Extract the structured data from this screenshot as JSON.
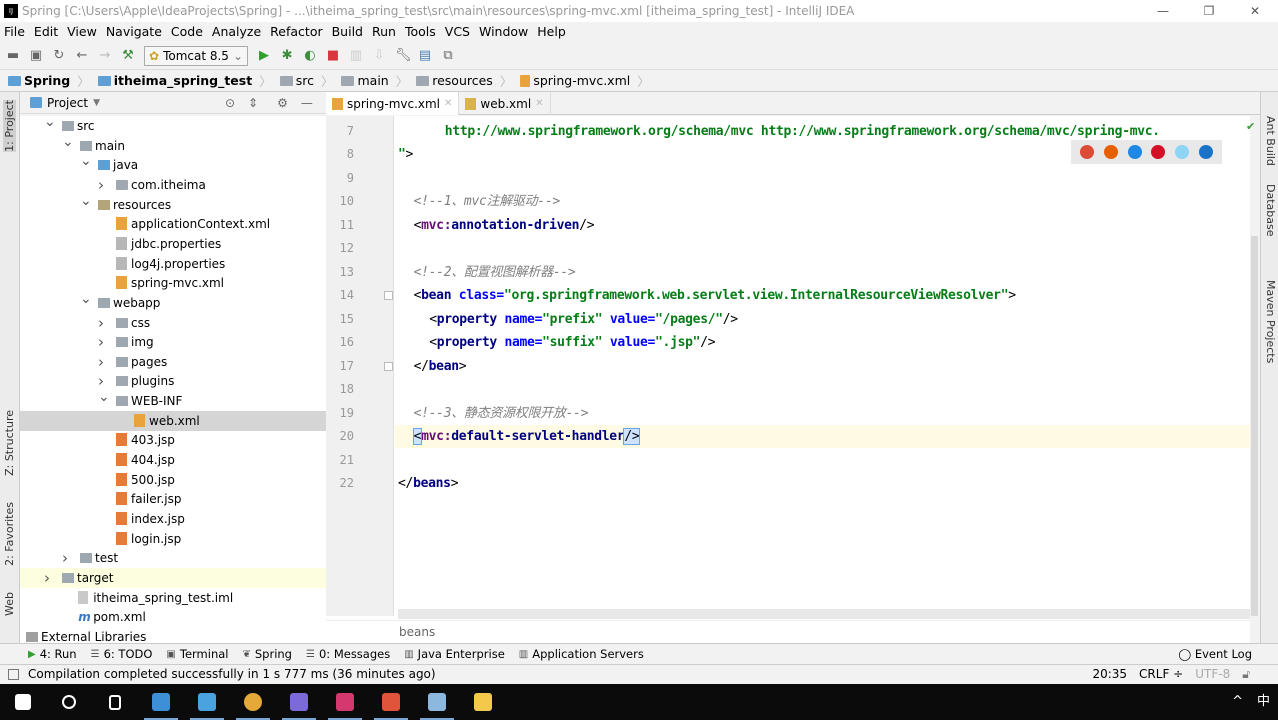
{
  "window": {
    "title": "Spring [C:\\Users\\Apple\\IdeaProjects\\Spring] - ...\\itheima_spring_test\\src\\main\\resources\\spring-mvc.xml [itheima_spring_test] - IntelliJ IDEA",
    "logo": "IJ",
    "controls": [
      "—",
      "❐",
      "✕"
    ]
  },
  "menu": [
    "File",
    "Edit",
    "View",
    "Navigate",
    "Code",
    "Analyze",
    "Refactor",
    "Build",
    "Run",
    "Tools",
    "VCS",
    "Window",
    "Help"
  ],
  "toolbar": {
    "run_config": "Tomcat 8.5",
    "icons": [
      "open-icon",
      "save-icon",
      "sync-icon",
      "back-icon",
      "forward-icon",
      "build-icon",
      "run-icon",
      "debug-icon",
      "coverage-icon",
      "stop-icon",
      "update-icon",
      "deploy-icon",
      "settings-icon",
      "project-structure-icon",
      "sdk-icon"
    ]
  },
  "breadcrumbs": [
    "Spring",
    "itheima_spring_test",
    "src",
    "main",
    "resources",
    "spring-mvc.xml"
  ],
  "left_stripe": [
    "1: Project",
    "Z: Structure",
    "2: Favorites",
    "Web"
  ],
  "right_stripe": [
    "Ant Build",
    "Database",
    "Maven Projects"
  ],
  "project": {
    "title": "Project",
    "tree": [
      {
        "label": "src",
        "depth": 0,
        "arrow": "down",
        "icon": "folder"
      },
      {
        "label": "main",
        "depth": 1,
        "arrow": "down",
        "icon": "folder"
      },
      {
        "label": "java",
        "depth": 2,
        "arrow": "down",
        "icon": "src"
      },
      {
        "label": "com.itheima",
        "depth": 3,
        "arrow": "right",
        "icon": "pkg"
      },
      {
        "label": "resources",
        "depth": 2,
        "arrow": "down",
        "icon": "res"
      },
      {
        "label": "applicationContext.xml",
        "depth": 3,
        "arrow": "",
        "icon": "xml"
      },
      {
        "label": "jdbc.properties",
        "depth": 3,
        "arrow": "",
        "icon": "props"
      },
      {
        "label": "log4j.properties",
        "depth": 3,
        "arrow": "",
        "icon": "props"
      },
      {
        "label": "spring-mvc.xml",
        "depth": 3,
        "arrow": "",
        "icon": "xml"
      },
      {
        "label": "webapp",
        "depth": 2,
        "arrow": "down",
        "icon": "folder"
      },
      {
        "label": "css",
        "depth": 3,
        "arrow": "right",
        "icon": "folder"
      },
      {
        "label": "img",
        "depth": 3,
        "arrow": "right",
        "icon": "folder"
      },
      {
        "label": "pages",
        "depth": 3,
        "arrow": "right",
        "icon": "folder"
      },
      {
        "label": "plugins",
        "depth": 3,
        "arrow": "right",
        "icon": "folder"
      },
      {
        "label": "WEB-INF",
        "depth": 3,
        "arrow": "down",
        "icon": "folder"
      },
      {
        "label": "web.xml",
        "depth": 4,
        "arrow": "",
        "icon": "xml",
        "selected": true
      },
      {
        "label": "403.jsp",
        "depth": 3,
        "arrow": "",
        "icon": "jsp"
      },
      {
        "label": "404.jsp",
        "depth": 3,
        "arrow": "",
        "icon": "jsp"
      },
      {
        "label": "500.jsp",
        "depth": 3,
        "arrow": "",
        "icon": "jsp"
      },
      {
        "label": "failer.jsp",
        "depth": 3,
        "arrow": "",
        "icon": "jsp"
      },
      {
        "label": "index.jsp",
        "depth": 3,
        "arrow": "",
        "icon": "jsp"
      },
      {
        "label": "login.jsp",
        "depth": 3,
        "arrow": "",
        "icon": "jsp"
      },
      {
        "label": "test",
        "depth": 1,
        "arrow": "right",
        "icon": "folder"
      },
      {
        "label": "target",
        "depth": 0,
        "arrow": "right",
        "icon": "folder",
        "highlight": true
      },
      {
        "label": "itheima_spring_test.iml",
        "depth": 0.9,
        "arrow": "",
        "icon": "iml"
      },
      {
        "label": "pom.xml",
        "depth": 0.9,
        "arrow": "",
        "icon": "pom"
      },
      {
        "label": "External Libraries",
        "depth": -2,
        "arrow": "right",
        "icon": "lib"
      }
    ]
  },
  "tabs": [
    {
      "label": "spring-mvc.xml",
      "active": true
    },
    {
      "label": "web.xml",
      "active": false
    }
  ],
  "editor": {
    "lines": [
      {
        "n": "7",
        "indent": 3,
        "tokens": [
          [
            "http://www.springframework.org/schema/mvc http://www.springframework.org/schema/mvc/spring-mvc.",
            "str"
          ]
        ]
      },
      {
        "n": "8",
        "indent": 0,
        "tokens": [
          [
            "\"",
            "str"
          ],
          [
            ">",
            "br"
          ]
        ]
      },
      {
        "n": "9",
        "indent": 0,
        "tokens": []
      },
      {
        "n": "10",
        "indent": 1,
        "tokens": [
          [
            "<!--1、mvc注解驱动-->",
            "cm"
          ]
        ]
      },
      {
        "n": "11",
        "indent": 1,
        "tokens": [
          [
            "<",
            "br"
          ],
          [
            "mvc:",
            "ns"
          ],
          [
            "annotation-driven",
            "tag"
          ],
          [
            "/>",
            "br"
          ]
        ]
      },
      {
        "n": "12",
        "indent": 0,
        "tokens": []
      },
      {
        "n": "13",
        "indent": 1,
        "tokens": [
          [
            "<!--2、配置视图解析器-->",
            "cm"
          ]
        ]
      },
      {
        "n": "14",
        "indent": 1,
        "tokens": [
          [
            "<",
            "br"
          ],
          [
            "bean ",
            "tag"
          ],
          [
            "class=",
            "attr"
          ],
          [
            "\"org.springframework.web.servlet.view.InternalResourceViewResolver\"",
            "str"
          ],
          [
            ">",
            "br"
          ]
        ]
      },
      {
        "n": "15",
        "indent": 2,
        "tokens": [
          [
            "<",
            "br"
          ],
          [
            "property ",
            "tag"
          ],
          [
            "name=",
            "attr"
          ],
          [
            "\"prefix\" ",
            "str"
          ],
          [
            "value=",
            "attr"
          ],
          [
            "\"/pages/\"",
            "str"
          ],
          [
            "/>",
            "br"
          ]
        ]
      },
      {
        "n": "16",
        "indent": 2,
        "tokens": [
          [
            "<",
            "br"
          ],
          [
            "property ",
            "tag"
          ],
          [
            "name=",
            "attr"
          ],
          [
            "\"suffix\" ",
            "str"
          ],
          [
            "value=",
            "attr"
          ],
          [
            "\".jsp\"",
            "str"
          ],
          [
            "/>",
            "br"
          ]
        ]
      },
      {
        "n": "17",
        "indent": 1,
        "tokens": [
          [
            "</",
            "br"
          ],
          [
            "bean",
            "tag"
          ],
          [
            ">",
            "br"
          ]
        ]
      },
      {
        "n": "18",
        "indent": 0,
        "tokens": []
      },
      {
        "n": "19",
        "indent": 1,
        "tokens": [
          [
            "<!--3、静态资源权限开放-->",
            "cm"
          ]
        ]
      },
      {
        "n": "20",
        "indent": 1,
        "current": true,
        "tokens": [
          [
            "<",
            "sel"
          ],
          [
            "mvc:",
            "ns"
          ],
          [
            "default-servlet-handler",
            "tag"
          ],
          [
            "/>",
            "sel"
          ]
        ]
      },
      {
        "n": "21",
        "indent": 0,
        "tokens": []
      },
      {
        "n": "22",
        "indent": 0,
        "tokens": [
          [
            "</",
            "br"
          ],
          [
            "beans",
            "tag"
          ],
          [
            ">",
            "br"
          ]
        ]
      }
    ],
    "breadcrumb": "beans",
    "browser_icons": [
      {
        "name": "chrome-icon",
        "color": "#dd4b39"
      },
      {
        "name": "firefox-icon",
        "color": "#e66000"
      },
      {
        "name": "safari-icon",
        "color": "#1e88e5"
      },
      {
        "name": "opera-icon",
        "color": "#d50f25"
      },
      {
        "name": "ie-icon",
        "color": "#8fd3f5"
      },
      {
        "name": "edge-icon",
        "color": "#1a73c8"
      }
    ]
  },
  "tool_windows": [
    "4: Run",
    "6: TODO",
    "Terminal",
    "Spring",
    "0: Messages",
    "Java Enterprise",
    "Application Servers"
  ],
  "event_log": "Event Log",
  "status": {
    "message": "Compilation completed successfully in 1 s 777 ms (36 minutes ago)",
    "position": "20:35",
    "line_sep": "CRLF ÷",
    "encoding": "UTF-8"
  },
  "taskbar": {
    "apps": [
      {
        "name": "start-icon",
        "color": "#ffffff"
      },
      {
        "name": "search-icon",
        "color": "#ffffff"
      },
      {
        "name": "task-view-icon",
        "color": "#ffffff"
      },
      {
        "name": "app-icon",
        "color": "#3d8fd6",
        "open": true
      },
      {
        "name": "app-icon",
        "color": "#4aa3df",
        "open": true
      },
      {
        "name": "chrome-icon",
        "color": "#e5a93a",
        "open": true
      },
      {
        "name": "app-icon",
        "color": "#7b6ad8",
        "open": true
      },
      {
        "name": "intellij-icon",
        "color": "#d5386e",
        "open": true
      },
      {
        "name": "powerpoint-icon",
        "color": "#e0543b",
        "open": true
      },
      {
        "name": "paint-icon",
        "color": "#8cb8e0",
        "open": true
      },
      {
        "name": "file-explorer-icon",
        "color": "#f3c94c",
        "open": false
      }
    ],
    "tray": [
      "^",
      "中"
    ]
  }
}
